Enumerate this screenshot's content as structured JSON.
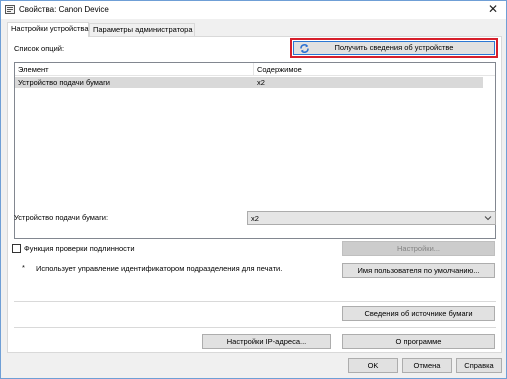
{
  "window": {
    "title": "Свойства: Canon Device",
    "close_glyph": "✕"
  },
  "tabs": [
    {
      "label": "Настройки устройства"
    },
    {
      "label": "Параметры администратора"
    }
  ],
  "options": {
    "label": "Список опций:",
    "get_info_button": "Получить сведения об устройстве",
    "columns": [
      "Элемент",
      "Содержимое"
    ],
    "rows": [
      {
        "item": "Устройство подачи бумаги",
        "content": "x2"
      }
    ]
  },
  "paper_feeder": {
    "label": "Устройство подачи бумаги:",
    "value": "x2"
  },
  "auth": {
    "checkbox_label": "Функция проверки подлинности",
    "settings_button": "Настройки...",
    "bullet": "*",
    "note": "Использует управление идентификатором подразделения для печати.",
    "default_user_button": "Имя пользователя по умолчанию..."
  },
  "paper_source_button": "Сведения об источнике бумаги",
  "ip_settings_button": "Настройки IP-адреса...",
  "about_button": "О программе",
  "footer": {
    "ok": "OK",
    "cancel": "Отмена",
    "help": "Справка"
  },
  "colors": {
    "focus_ring": "#d61f2b",
    "focus_border": "#2a77d4",
    "refresh_icon": "#2a6fd1",
    "selected_row": "#d9d9d9"
  },
  "icons": {
    "title": "printer-properties-icon",
    "refresh": "refresh-icon",
    "dropdown": "chevron-down-icon"
  }
}
